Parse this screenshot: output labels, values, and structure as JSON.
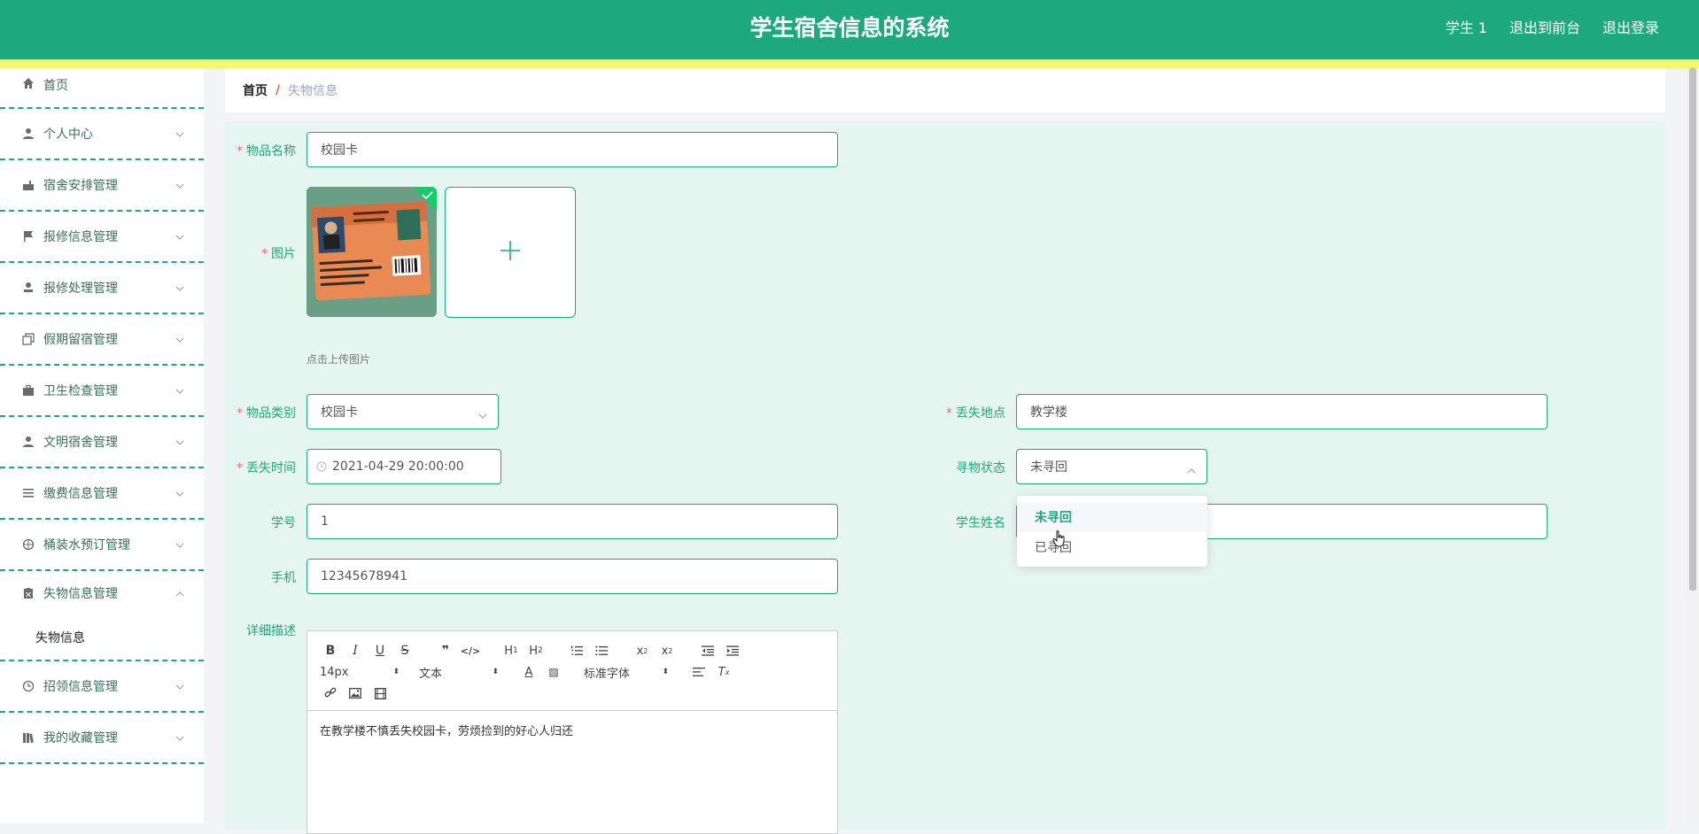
{
  "header": {
    "title": "学生宿舍信息的系统",
    "links": [
      "学生 1",
      "退出到前台",
      "退出登录"
    ]
  },
  "sidebar": {
    "items": [
      {
        "label": "首页",
        "icon": "home-icon"
      },
      {
        "label": "个人中心",
        "icon": "user-icon"
      },
      {
        "label": "宿舍安排管理",
        "icon": "mailbox-icon"
      },
      {
        "label": "报修信息管理",
        "icon": "flag-icon"
      },
      {
        "label": "报修处理管理",
        "icon": "stamp-icon"
      },
      {
        "label": "假期留宿管理",
        "icon": "copy-icon"
      },
      {
        "label": "卫生检查管理",
        "icon": "briefcase-icon"
      },
      {
        "label": "文明宿舍管理",
        "icon": "user-icon"
      },
      {
        "label": "缴费信息管理",
        "icon": "list-icon"
      },
      {
        "label": "桶装水预订管理",
        "icon": "dial-icon"
      },
      {
        "label": "失物信息管理",
        "icon": "clipboard-icon"
      },
      {
        "label": "招领信息管理",
        "icon": "clock-icon"
      },
      {
        "label": "我的收藏管理",
        "icon": "books-icon"
      }
    ],
    "open_submenu": "失物信息"
  },
  "breadcrumb": {
    "home": "首页",
    "separator": "/",
    "current": "失物信息"
  },
  "form": {
    "item_name": {
      "label": "物品名称",
      "value": "校园卡"
    },
    "image": {
      "label": "图片",
      "hint": "点击上传图片"
    },
    "category": {
      "label": "物品类别",
      "value": "校园卡"
    },
    "lost_place": {
      "label": "丢失地点",
      "value": "教学楼"
    },
    "lost_time": {
      "label": "丢失时间",
      "value": "2021-04-29 20:00:00"
    },
    "status": {
      "label": "寻物状态",
      "value": "未寻回",
      "options": [
        "未寻回",
        "已寻回"
      ]
    },
    "student_no": {
      "label": "学号",
      "value": "1"
    },
    "student_name": {
      "label": "学生姓名",
      "value": ""
    },
    "phone": {
      "label": "手机",
      "value": "12345678941"
    },
    "description": {
      "label": "详细描述",
      "font_size": "14px",
      "format": "文本",
      "font_family": "标准字体",
      "content": "在教学楼不慎丢失校园卡，劳烦捡到的好心人归还"
    }
  },
  "colors": {
    "primary": "#1ea97c",
    "accent_bar": "#f7f76b",
    "form_bg": "#e5f5ef",
    "required": "#f56c6c"
  }
}
